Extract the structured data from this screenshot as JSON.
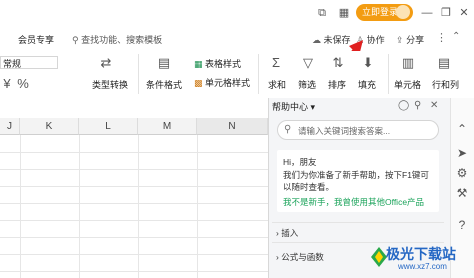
{
  "titlebar": {
    "login_label": "立即登录",
    "minimize": "—",
    "restore": "❐",
    "close": "✕",
    "layout": "⧉",
    "grid": "▦"
  },
  "menubar": {
    "member_label": "会员专享",
    "search_placeholder": "查找功能、搜索模板",
    "unsaved_label": "未保存",
    "collab_label": "协作",
    "share_label": "分享"
  },
  "ribbon": {
    "format_label": "常规",
    "currency_symbol": "¥",
    "percent": "%",
    "type_convert": "类型转换",
    "cond_format": "条件格式",
    "table_style": "表格样式",
    "cell_style": "单元格样式",
    "sum": "求和",
    "filter": "筛选",
    "sort": "排序",
    "fill": "填充",
    "cell": "单元格",
    "row_col": "行和列"
  },
  "grid": {
    "columns": [
      "J",
      "K",
      "L",
      "M",
      "N"
    ]
  },
  "help": {
    "title": "帮助中心",
    "search_placeholder": "请输入关键词搜索答案...",
    "greeting": "Hi，朋友",
    "intro": "我们为你准备了新手帮助，按下F1键可以随时查看。",
    "link": "我不是新手，我曾使用其他Office产品",
    "sections": [
      "插入",
      "公式与函数"
    ]
  },
  "watermark": {
    "name": "极光下载站",
    "url": "www.xz7.com"
  },
  "colors": {
    "accent": "#f39c12",
    "link": "#1aa35a",
    "arrow": "#e02020"
  }
}
